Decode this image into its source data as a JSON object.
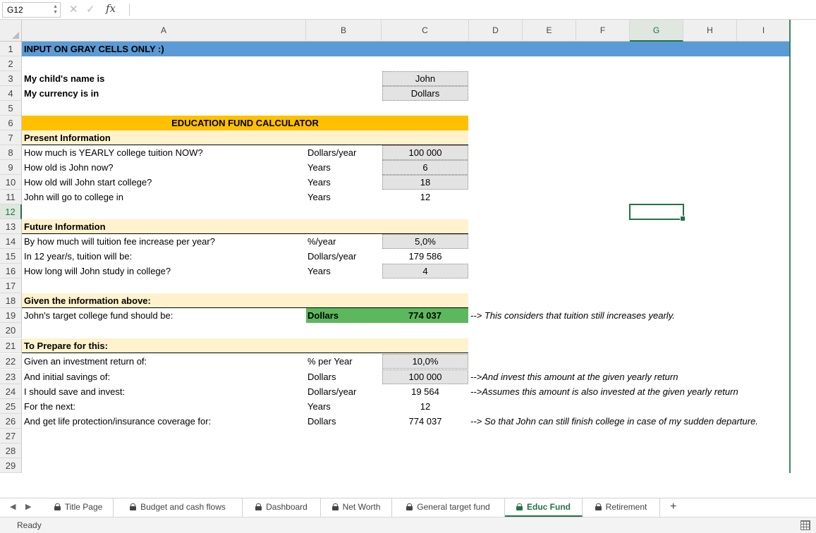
{
  "formula_bar": {
    "name_box": "G12",
    "cancel_icon": "✕",
    "enter_icon": "✓",
    "fx_label": "fx",
    "formula": ""
  },
  "columns": [
    "A",
    "B",
    "C",
    "D",
    "E",
    "F",
    "G",
    "H",
    "I"
  ],
  "selected_column": "G",
  "selected_row": "12",
  "rows": [
    "1",
    "2",
    "3",
    "4",
    "5",
    "6",
    "7",
    "8",
    "9",
    "10",
    "11",
    "12",
    "13",
    "14",
    "15",
    "16",
    "17",
    "18",
    "19",
    "20",
    "21",
    "22",
    "23",
    "24",
    "25",
    "26",
    "27",
    "28",
    "29"
  ],
  "cells": {
    "r1": {
      "a": "INPUT ON GRAY CELLS ONLY :)"
    },
    "r3": {
      "a": "My child's name is",
      "c": "John"
    },
    "r4": {
      "a": "My currency is in",
      "c": "Dollars"
    },
    "r6": {
      "a": "EDUCATION FUND CALCULATOR"
    },
    "r7": {
      "a": "Present Information"
    },
    "r8": {
      "a": "How much is YEARLY college tuition NOW?",
      "b": "Dollars/year",
      "c": "100 000"
    },
    "r9": {
      "a": "How old is John now?",
      "b": "Years",
      "c": "6"
    },
    "r10": {
      "a": "How old will John start college?",
      "b": "Years",
      "c": "18"
    },
    "r11": {
      "a": "John will go to college in",
      "b": "Years",
      "c": "12"
    },
    "r13": {
      "a": "Future Information"
    },
    "r14": {
      "a": "By how much will tuition fee increase per year?",
      "b": "%/year",
      "c": "5,0%"
    },
    "r15": {
      "a": "In 12 year/s, tuition will be:",
      "b": "Dollars/year",
      "c": "179 586"
    },
    "r16": {
      "a": "How long will John study in college?",
      "b": "Years",
      "c": "4"
    },
    "r18": {
      "a": "Given the information above:"
    },
    "r19": {
      "a": "John's target college fund should be:",
      "b": "Dollars",
      "c": "774 037",
      "d": "--> This considers that tuition still increases yearly."
    },
    "r21": {
      "a": "To Prepare for this:"
    },
    "r22": {
      "a": "Given an investment return of:",
      "b": "% per Year",
      "c": "10,0%"
    },
    "r23": {
      "a": "And initial savings of:",
      "b": "Dollars",
      "c": "100 000",
      "d": "-->And invest this amount at the given yearly return"
    },
    "r24": {
      "a": "I should save and invest:",
      "b": "Dollars/year",
      "c": "19 564",
      "d": "-->Assumes this amount is also invested at the given yearly return"
    },
    "r25": {
      "a": "For the next:",
      "b": "Years",
      "c": "12"
    },
    "r26": {
      "a": "And get life protection/insurance coverage for:",
      "b": "Dollars",
      "c": "774 037",
      "d": "--> So that John can still finish college in case of my sudden departure."
    }
  },
  "tabs": [
    {
      "label": "Title Page",
      "locked": true
    },
    {
      "label": "Budget and cash flows",
      "locked": true
    },
    {
      "label": "Dashboard",
      "locked": true
    },
    {
      "label": "Net Worth",
      "locked": true
    },
    {
      "label": "General target fund",
      "locked": true
    },
    {
      "label": "Educ Fund",
      "locked": true,
      "active": true
    },
    {
      "label": "Retirement",
      "locked": true
    }
  ],
  "tab_nav": {
    "prev": "◀",
    "next": "▶",
    "add": "+"
  },
  "status": "Ready",
  "colors": {
    "accent": "#217346",
    "header_blue": "#5b9bd5",
    "title_gold": "#ffc000",
    "section_cream": "#fff2cc",
    "result_green": "#5cb85c",
    "input_gray": "#e3e3e3"
  }
}
